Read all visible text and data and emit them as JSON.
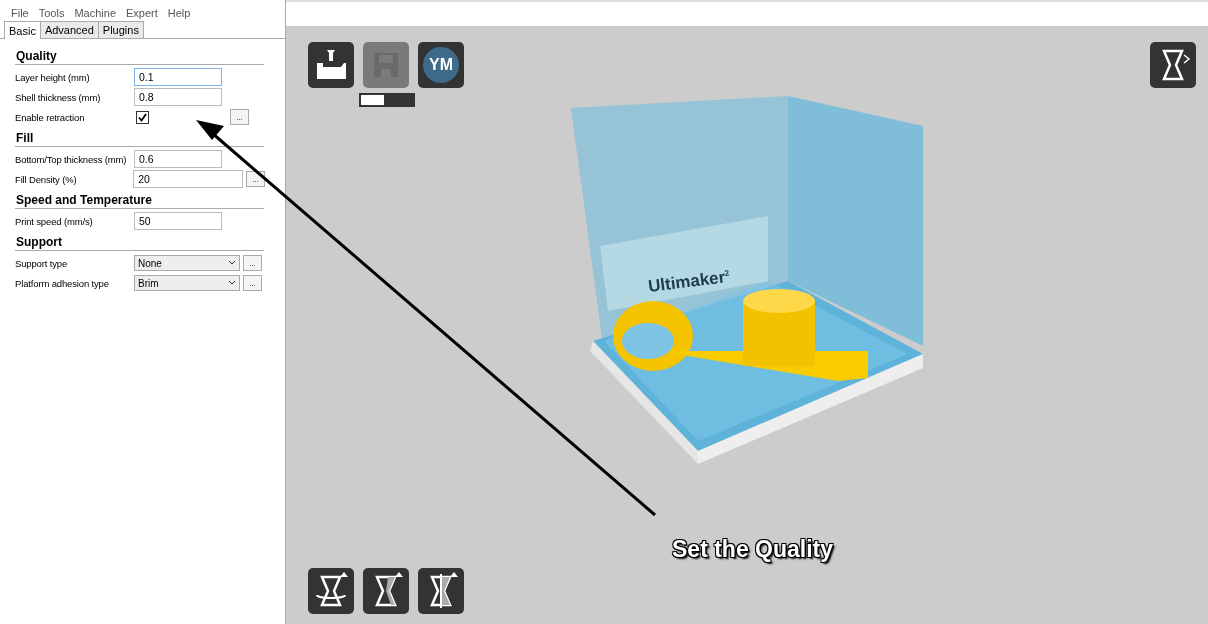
{
  "menu": [
    "File",
    "Tools",
    "Machine",
    "Expert",
    "Help"
  ],
  "tabs": [
    {
      "label": "Basic",
      "selected": true
    },
    {
      "label": "Advanced",
      "selected": false
    },
    {
      "label": "Plugins",
      "selected": false
    }
  ],
  "sections": [
    {
      "title": "Quality",
      "rows": [
        {
          "kind": "text",
          "label": "Layer height (mm)",
          "value": "0.1",
          "focused": true,
          "more": false
        },
        {
          "kind": "text",
          "label": "Shell thickness (mm)",
          "value": "0.8",
          "focused": false,
          "more": false
        },
        {
          "kind": "checkbox",
          "label": "Enable retraction",
          "checked": true,
          "more": true,
          "more_label": "..."
        }
      ]
    },
    {
      "title": "Fill",
      "rows": [
        {
          "kind": "text",
          "label": "Bottom/Top thickness (mm)",
          "value": "0.6",
          "focused": false,
          "more": false
        },
        {
          "kind": "text",
          "label": "Fill Density (%)",
          "value": "20",
          "focused": false,
          "more": true,
          "more_label": "..."
        }
      ]
    },
    {
      "title": "Speed and Temperature",
      "rows": [
        {
          "kind": "text",
          "label": "Print speed (mm/s)",
          "value": "50",
          "focused": false,
          "more": false
        }
      ]
    },
    {
      "title": "Support",
      "rows": [
        {
          "kind": "select",
          "label": "Support type",
          "value": "None",
          "more": true,
          "more_label": "..."
        },
        {
          "kind": "select",
          "label": "Platform adhesion type",
          "value": "Brim",
          "more": true,
          "more_label": "..."
        }
      ]
    }
  ],
  "viewport": {
    "save_progress": {
      "level": 0.45
    },
    "load_enabled": true,
    "save_enabled": false,
    "youmagine_label": "YM",
    "backplate_label": "Ultimaker$^{2}$"
  },
  "annotation": {
    "text": "Set the Quality"
  }
}
